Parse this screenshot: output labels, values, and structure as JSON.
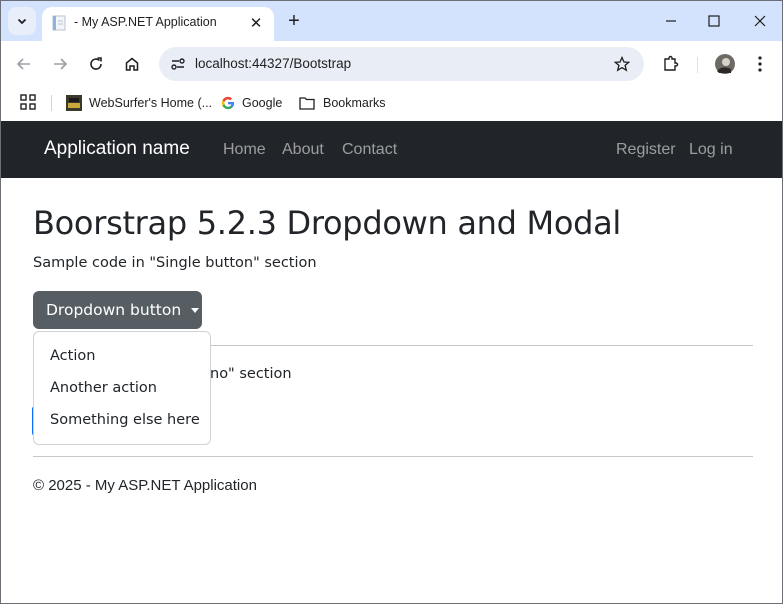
{
  "browser": {
    "tab": {
      "title": "- My ASP.NET Application"
    },
    "address_bar": {
      "url": "localhost:44327/Bootstrap"
    },
    "bookmarks": [
      {
        "label": "WebSurfer's Home (..."
      },
      {
        "label": "Google"
      },
      {
        "label": "Bookmarks"
      }
    ]
  },
  "navbar": {
    "brand": "Application name",
    "left_links": [
      "Home",
      "About",
      "Contact"
    ],
    "right_links": [
      "Register",
      "Log in"
    ]
  },
  "main": {
    "title": "Boorstrap 5.2.3 Dropdown and Modal",
    "section1_text": "Sample code in \"Single button\" section",
    "dropdown": {
      "button_label": "Dropdown button",
      "items": [
        "Action",
        "Another action",
        "Something else here"
      ]
    },
    "section2_partial_text": "no\" section"
  },
  "footer": {
    "text": "© 2025 - My ASP.NET Application"
  },
  "colors": {
    "navbar_bg": "#212529",
    "dropdown_btn_bg": "#565e64",
    "tabstrip_bg": "#d3e3fd"
  }
}
